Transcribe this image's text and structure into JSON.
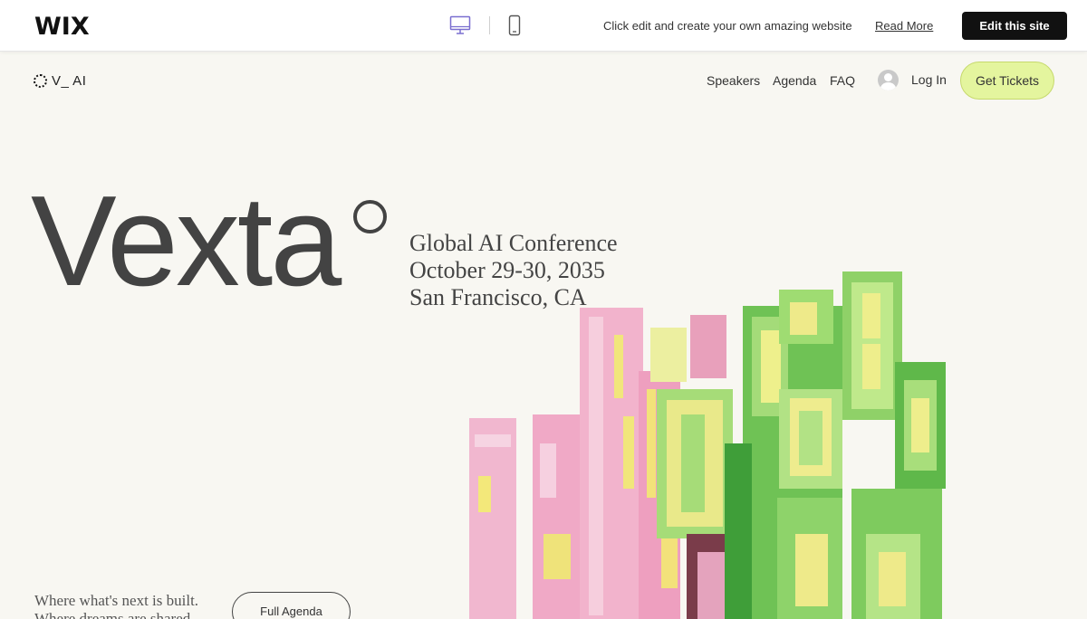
{
  "wix_bar": {
    "logo": "WIX",
    "message": "Click edit and create your own amazing website",
    "read_more": "Read More",
    "edit_button": "Edit this site",
    "icons": [
      "desktop-icon",
      "mobile-icon"
    ]
  },
  "site": {
    "logo_text": "V_ AI",
    "nav": [
      "Speakers",
      "Agenda",
      "FAQ"
    ],
    "login": "Log In",
    "cta": "Get Tickets",
    "colors": {
      "cta_bg": "#e4f59e",
      "background": "#f8f7f2"
    }
  },
  "hero": {
    "title": "Vexta",
    "line1": "Global AI Conference",
    "line2": "October 29-30, 2035",
    "line3": "San Francisco, CA",
    "tagline1": "Where what's next is built.",
    "tagline2": "Where dreams are shared.",
    "agenda_button": "Full Agenda"
  }
}
